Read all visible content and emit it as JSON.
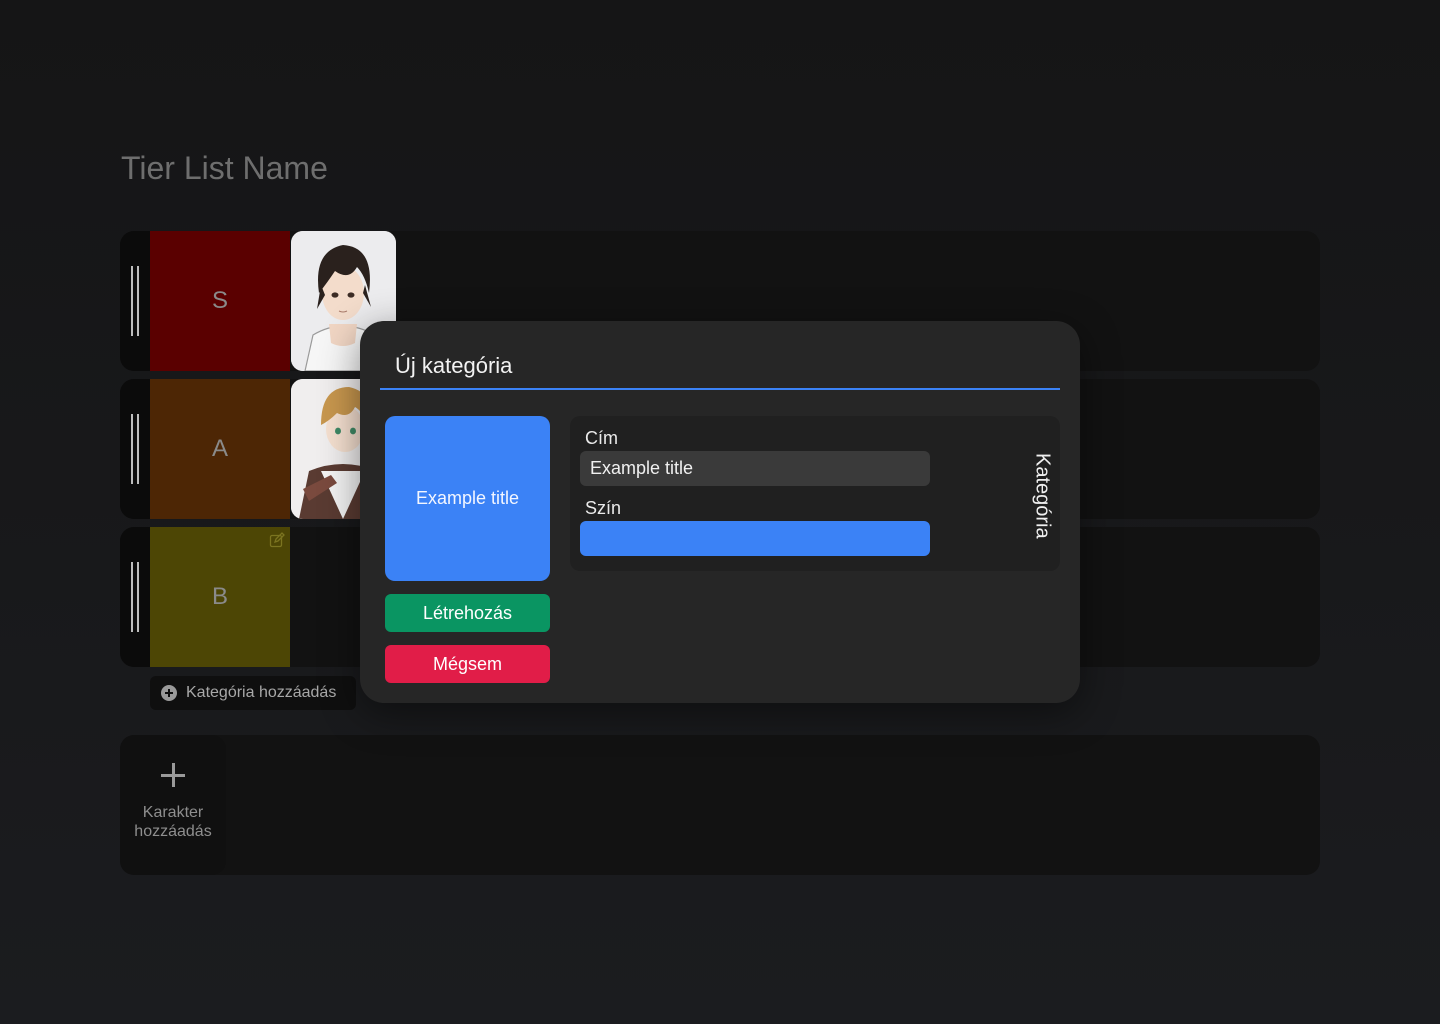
{
  "page": {
    "title": "Tier List Name"
  },
  "tiers": [
    {
      "label": "S",
      "color": "#5a0000"
    },
    {
      "label": "A",
      "color": "#4d2605"
    },
    {
      "label": "B",
      "color": "#4d4605"
    }
  ],
  "actions": {
    "add_category": "Kategória hozzáadás",
    "add_character": "Karakter hozzáadás"
  },
  "modal": {
    "title": "Új kategória",
    "preview_text": "Example title",
    "title_label": "Cím",
    "title_value": "Example title",
    "color_label": "Szín",
    "color_value": "#3b82f6",
    "side_label": "Kategória",
    "create_button": "Létrehozás",
    "cancel_button": "Mégsem"
  },
  "icons": {
    "drag": "drag-handle-icon",
    "edit": "edit-icon",
    "add_circle": "plus-circle-icon",
    "add": "plus-icon"
  }
}
